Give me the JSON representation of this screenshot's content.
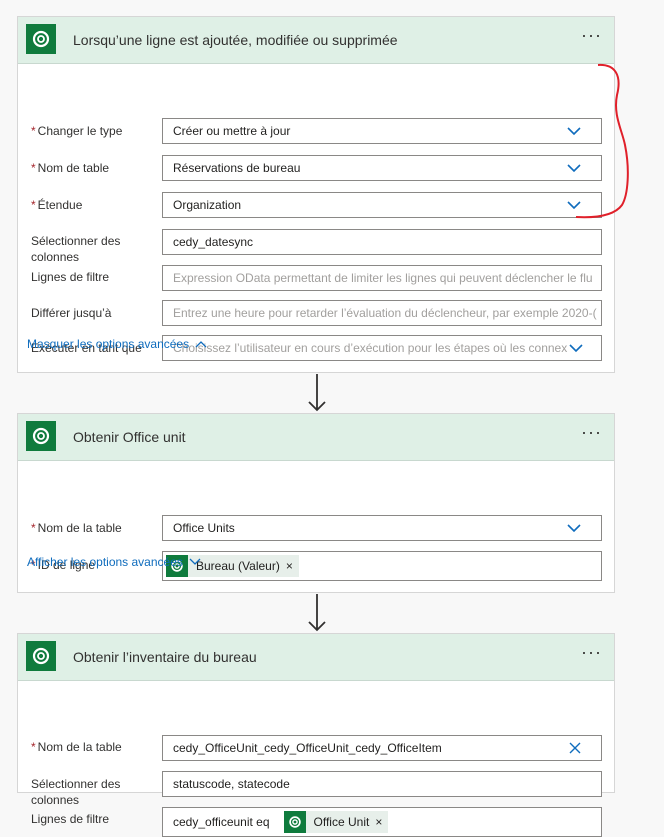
{
  "card1": {
    "title": "Lorsqu’une ligne est ajoutée, modifiée ou supprimée",
    "menu": "···",
    "fields": [
      {
        "label": "Changer le type",
        "required": "*",
        "value": "Créer ou mettre à jour"
      },
      {
        "label": "Nom de table",
        "required": "*",
        "value": "Réservations de bureau"
      },
      {
        "label": "Étendue",
        "required": "*",
        "value": "Organization"
      },
      {
        "label": "Sélectionner des colonnes",
        "value": "cedy_datesync"
      },
      {
        "label": "Lignes de filtre",
        "placeholder": "Expression OData permettant de limiter les lignes qui peuvent déclencher le flu"
      },
      {
        "label": "Différer jusqu’à",
        "placeholder": "Entrez une heure pour retarder l’évaluation du déclencheur, par exemple 2020-("
      },
      {
        "label": "Exécuter en tant que",
        "placeholder": "Choisissez l’utilisateur en cours d’exécution pour les étapes où les connex"
      }
    ],
    "advanced": "Masquer les options avancées"
  },
  "card2": {
    "title": "Obtenir Office unit",
    "menu": "···",
    "fields": [
      {
        "label": "Nom de la table",
        "required": "*",
        "value": "Office Units"
      },
      {
        "label": "ID de ligne",
        "required": "*",
        "token": "Bureau (Valeur)",
        "token_close": "×"
      }
    ],
    "advanced": "Afficher les options avancées"
  },
  "card3": {
    "title": "Obtenir l’inventaire du bureau",
    "menu": "···",
    "fields": [
      {
        "label": "Nom de la table",
        "required": "*",
        "value": "cedy_OfficeUnit_cedy_OfficeUnit_cedy_OfficeItem"
      },
      {
        "label": "Sélectionner des colonnes",
        "value": "statuscode, statecode"
      },
      {
        "label": "Lignes de filtre",
        "prefix": "cedy_officeunit eq",
        "token": "Office Unit",
        "token_close": "×"
      }
    ]
  },
  "colors": {
    "header": "#dff0e6",
    "logo": "#0f7b3d",
    "link": "#0f6cbd",
    "required": "#a4262c",
    "annotation": "#e0202a"
  },
  "icons": [
    "dataverse-logo-icon",
    "chevron-down-icon",
    "chevron-up-icon",
    "close-icon",
    "arrow-down-icon",
    "more-icon"
  ]
}
